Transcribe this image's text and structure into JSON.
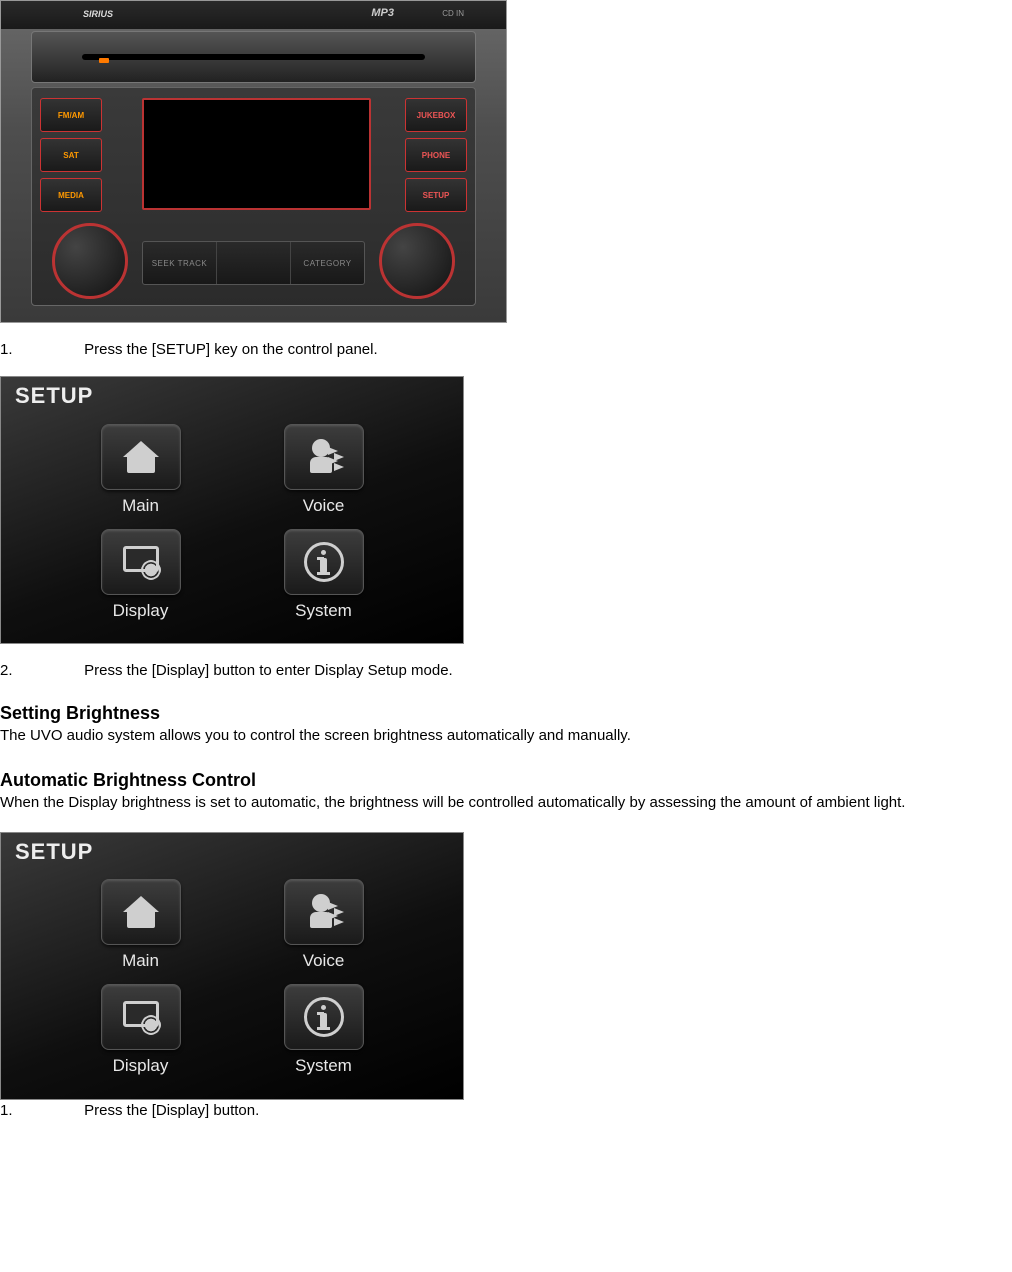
{
  "panel": {
    "brand": "SIRIUS",
    "mp3": "MP3",
    "cdin": "CD IN",
    "left_buttons": [
      "FM/AM",
      "SAT",
      "MEDIA"
    ],
    "right_buttons": [
      "JUKEBOX",
      "PHONE",
      "SETUP"
    ],
    "bottom_segments_left": "SEEK TRACK",
    "bottom_segments_mid": "",
    "bottom_segments_right": "CATEGORY"
  },
  "steps": {
    "s1_num": "1.",
    "s1_text": "Press the [SETUP] key on the control panel.",
    "s2_num": "2.",
    "s2_text": "Press the [Display] button to enter Display Setup mode.",
    "s3_num": "1.",
    "s3_text": "Press the [Display] button."
  },
  "headings": {
    "h1": "Setting Brightness",
    "h1_body": "The UVO audio system allows you to control the screen brightness automatically and manually.",
    "h2": "Automatic Brightness Control",
    "h2_body": "When the Display brightness is set to automatic, the brightness will be controlled automatically by assessing the amount of ambient light."
  },
  "setup": {
    "title": "SETUP",
    "items": [
      {
        "label": "Main"
      },
      {
        "label": "Voice"
      },
      {
        "label": "Display"
      },
      {
        "label": "System"
      }
    ]
  }
}
